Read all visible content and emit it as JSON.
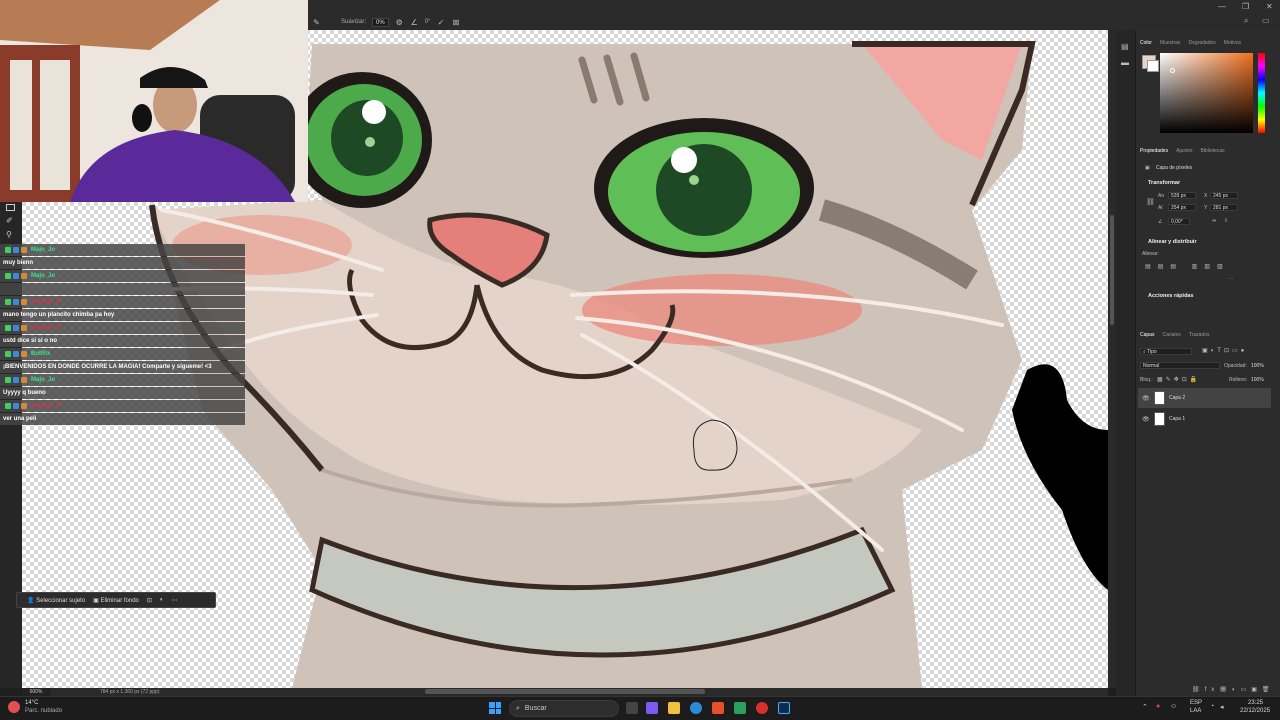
{
  "options_bar": {
    "smooth_label": "Suavizar:",
    "smooth_value": "0%",
    "angle_value": "0°"
  },
  "chat": [
    {
      "user": "Majo_Jo",
      "user_color": "#3fe08c",
      "message": "muy bienn"
    },
    {
      "user": "Majo_Jo",
      "user_color": "#3fe08c",
      "message": ""
    },
    {
      "user": "brayner_ff",
      "user_color": "#e0304a",
      "message": "mano tengo un plancito chimba pa hoy"
    },
    {
      "user": "brayner_ff",
      "user_color": "#e0304a",
      "message": "ustd dice si sí o no"
    },
    {
      "user": "BotRix",
      "user_color": "#3fe08c",
      "message": "¡BIENVENIDOS EN DONDE OCURRE LA MAGIA! Comparte y sígueme! <3"
    },
    {
      "user": "Majo_Jo",
      "user_color": "#3fe08c",
      "message": "Uyyyy q bueno"
    },
    {
      "user": "brayner_ff",
      "user_color": "#e0304a",
      "message": "ver una peli"
    }
  ],
  "context_bar": {
    "select_subject": "Seleccionar sujeto",
    "remove_bg": "Eliminar fondo"
  },
  "status": {
    "zoom": "600%",
    "doc_info": "784 px x 1.360 px (72 ppp)"
  },
  "color_panel": {
    "tabs": [
      "Color",
      "Muestras",
      "Degradados",
      "Motivos"
    ]
  },
  "properties_panel": {
    "tabs": [
      "Propiedades",
      "Ajustes",
      "Bibliotecas"
    ],
    "layer_type": "Capa de píxeles",
    "transform_title": "Transformar",
    "w_label": "An",
    "w_value": "539 px",
    "h_label": "Al",
    "h_value": "254 px",
    "x_label": "X",
    "x_value": "245 px",
    "y_label": "Y",
    "y_value": "281 px",
    "angle": "0,00°",
    "align_title": "Alinear y distribuir",
    "align_label": "Alinear:",
    "quick_actions": "Acciones rápidas"
  },
  "layers_panel": {
    "tabs": [
      "Capas",
      "Canales",
      "Trazados"
    ],
    "filter": "Tipo",
    "blend_mode": "Normal",
    "opacity_label": "Opacidad:",
    "opacity_value": "100%",
    "lock_label": "Bloq.:",
    "fill_label": "Relleno:",
    "fill_value": "100%",
    "layers": [
      {
        "name": "Capa 2",
        "selected": true
      },
      {
        "name": "Capa 1",
        "selected": false
      }
    ]
  },
  "taskbar": {
    "weather_temp": "14°C",
    "weather_desc": "Parc. nublado",
    "search_placeholder": "Buscar",
    "lang_top": "ESP",
    "lang_bottom": "LAA",
    "time": "23:25",
    "date": "22/12/2025"
  }
}
